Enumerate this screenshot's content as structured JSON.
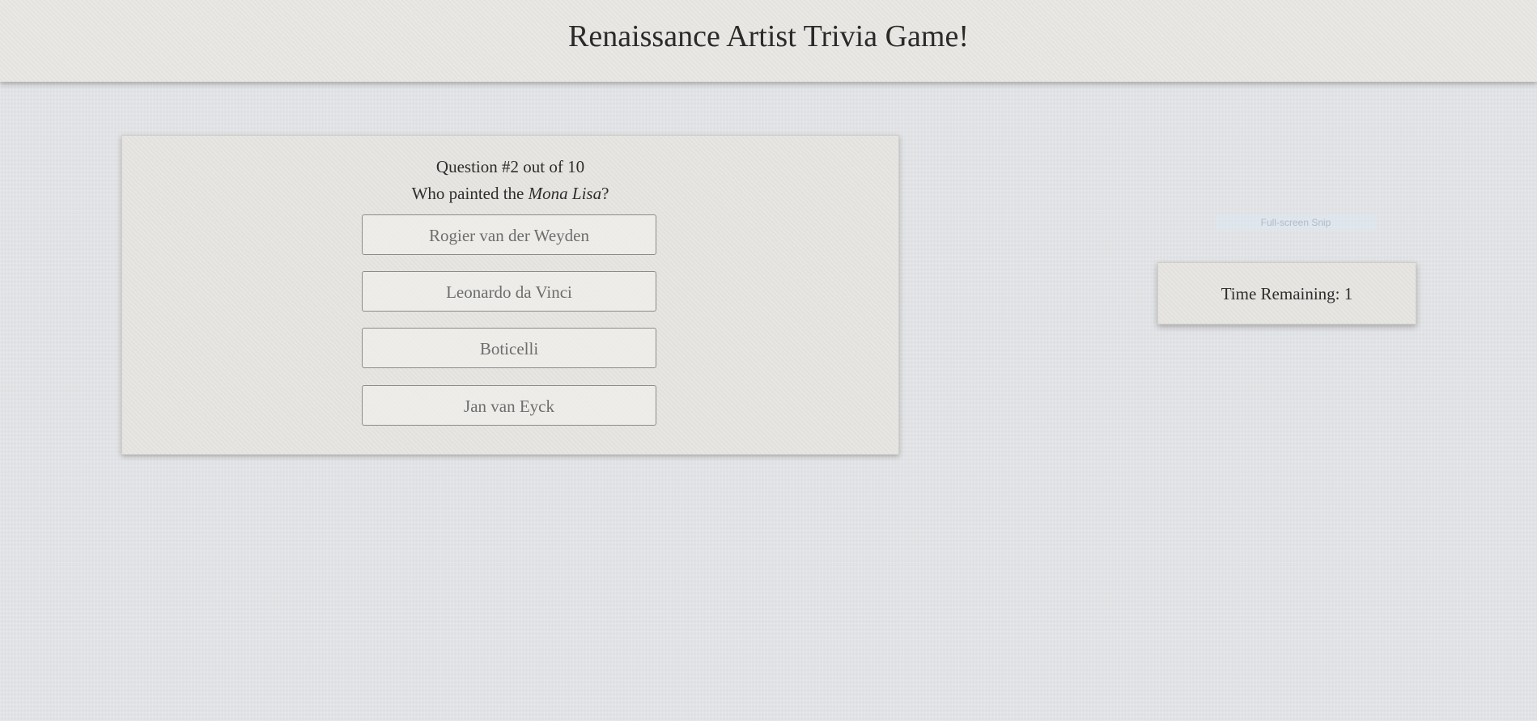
{
  "header": {
    "title": "Renaissance Artist Trivia Game!"
  },
  "quiz": {
    "counter": "Question #2 out of 10",
    "question_prefix": "Who painted the ",
    "question_emphasis": "Mona Lisa",
    "question_suffix": "?",
    "answers": [
      "Rogier van der Weyden",
      "Leonardo da Vinci",
      "Boticelli",
      "Jan van Eyck"
    ]
  },
  "overlay": {
    "fullscreen_snip_label": "Full-screen Snip"
  },
  "timer": {
    "label": "Time Remaining: 1"
  }
}
